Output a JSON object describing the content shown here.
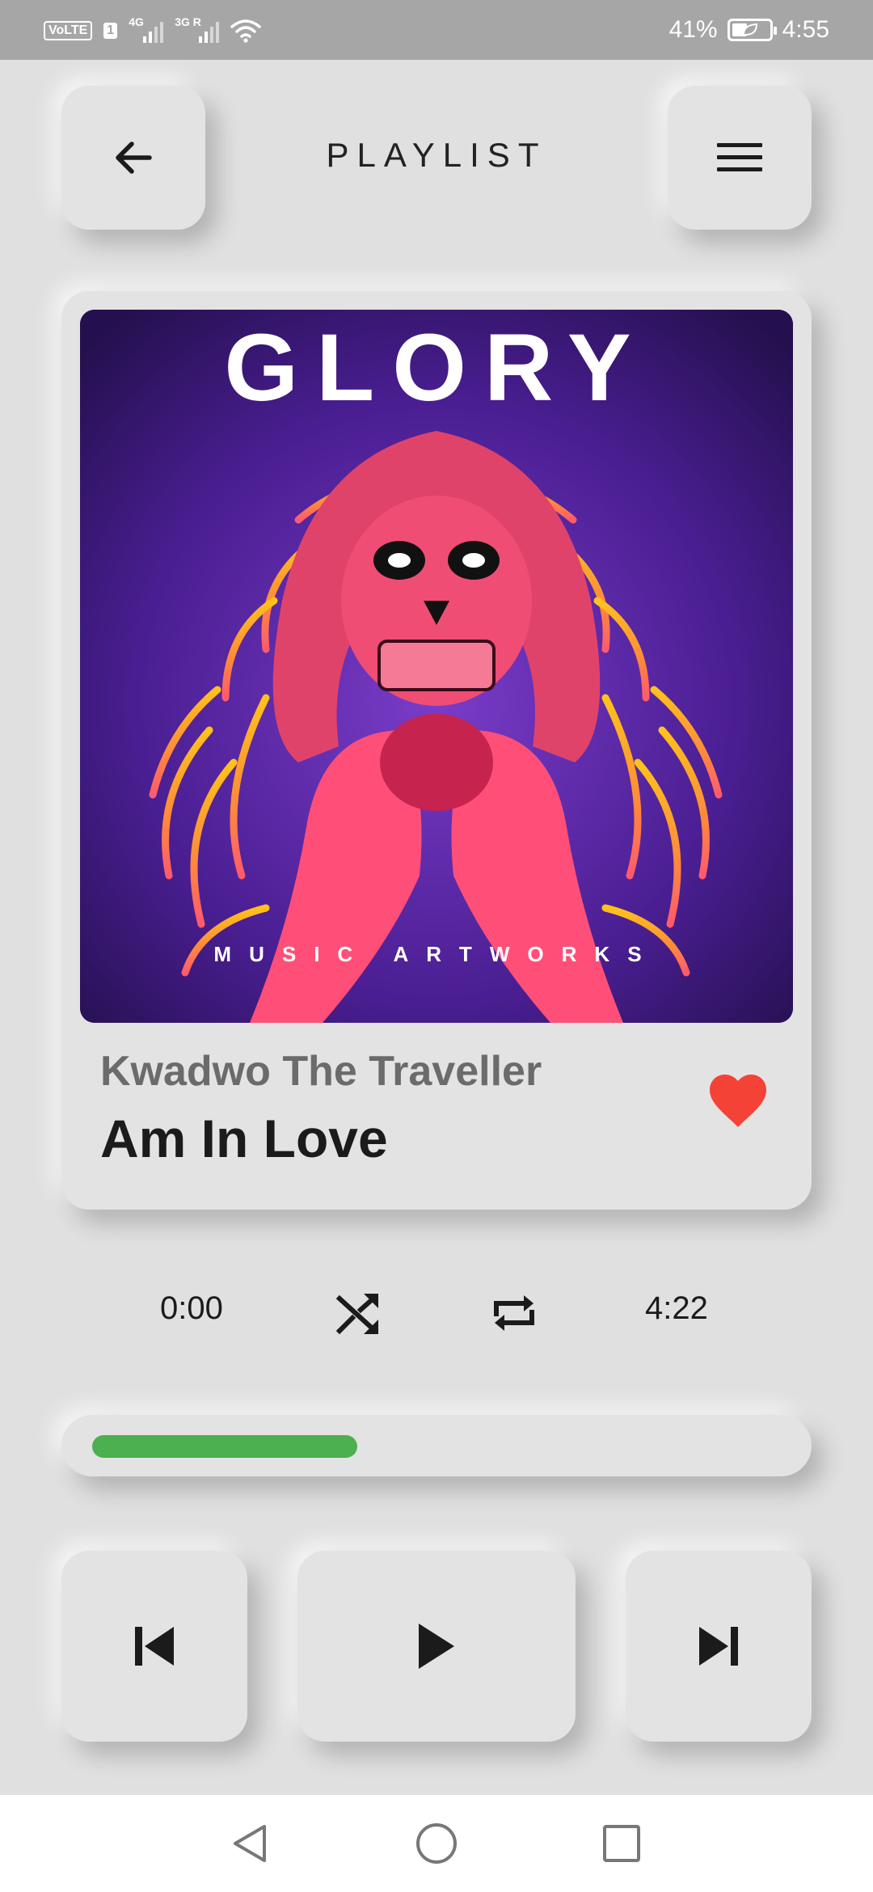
{
  "status_bar": {
    "volte": "VoLTE",
    "sim_badge": "1",
    "network_1": "4G",
    "network_2": "3G R",
    "battery_percent": "41%",
    "battery_level": 0.41,
    "time": "4:55"
  },
  "header": {
    "title": "PLAYLIST",
    "back_icon": "arrow-left-icon",
    "menu_icon": "hamburger-menu-icon"
  },
  "track": {
    "artwork_title": "GLORY",
    "artwork_subtitle": "MUSIC ARTWORKS",
    "artist": "Kwadwo The Traveller",
    "title": "Am In Love",
    "favorite": true,
    "favorite_icon": "heart-icon",
    "favorite_color": "#f44336"
  },
  "playback": {
    "current_time": "0:00",
    "duration": "4:22",
    "progress": 0.385,
    "progress_color": "#4caf50",
    "shuffle_icon": "shuffle-icon",
    "repeat_icon": "repeat-icon"
  },
  "controls": {
    "previous_icon": "skip-previous-icon",
    "play_icon": "play-icon",
    "next_icon": "skip-next-icon"
  },
  "nav_bar": {
    "back_icon": "nav-back-icon",
    "home_icon": "nav-home-icon",
    "recents_icon": "nav-recents-icon"
  }
}
